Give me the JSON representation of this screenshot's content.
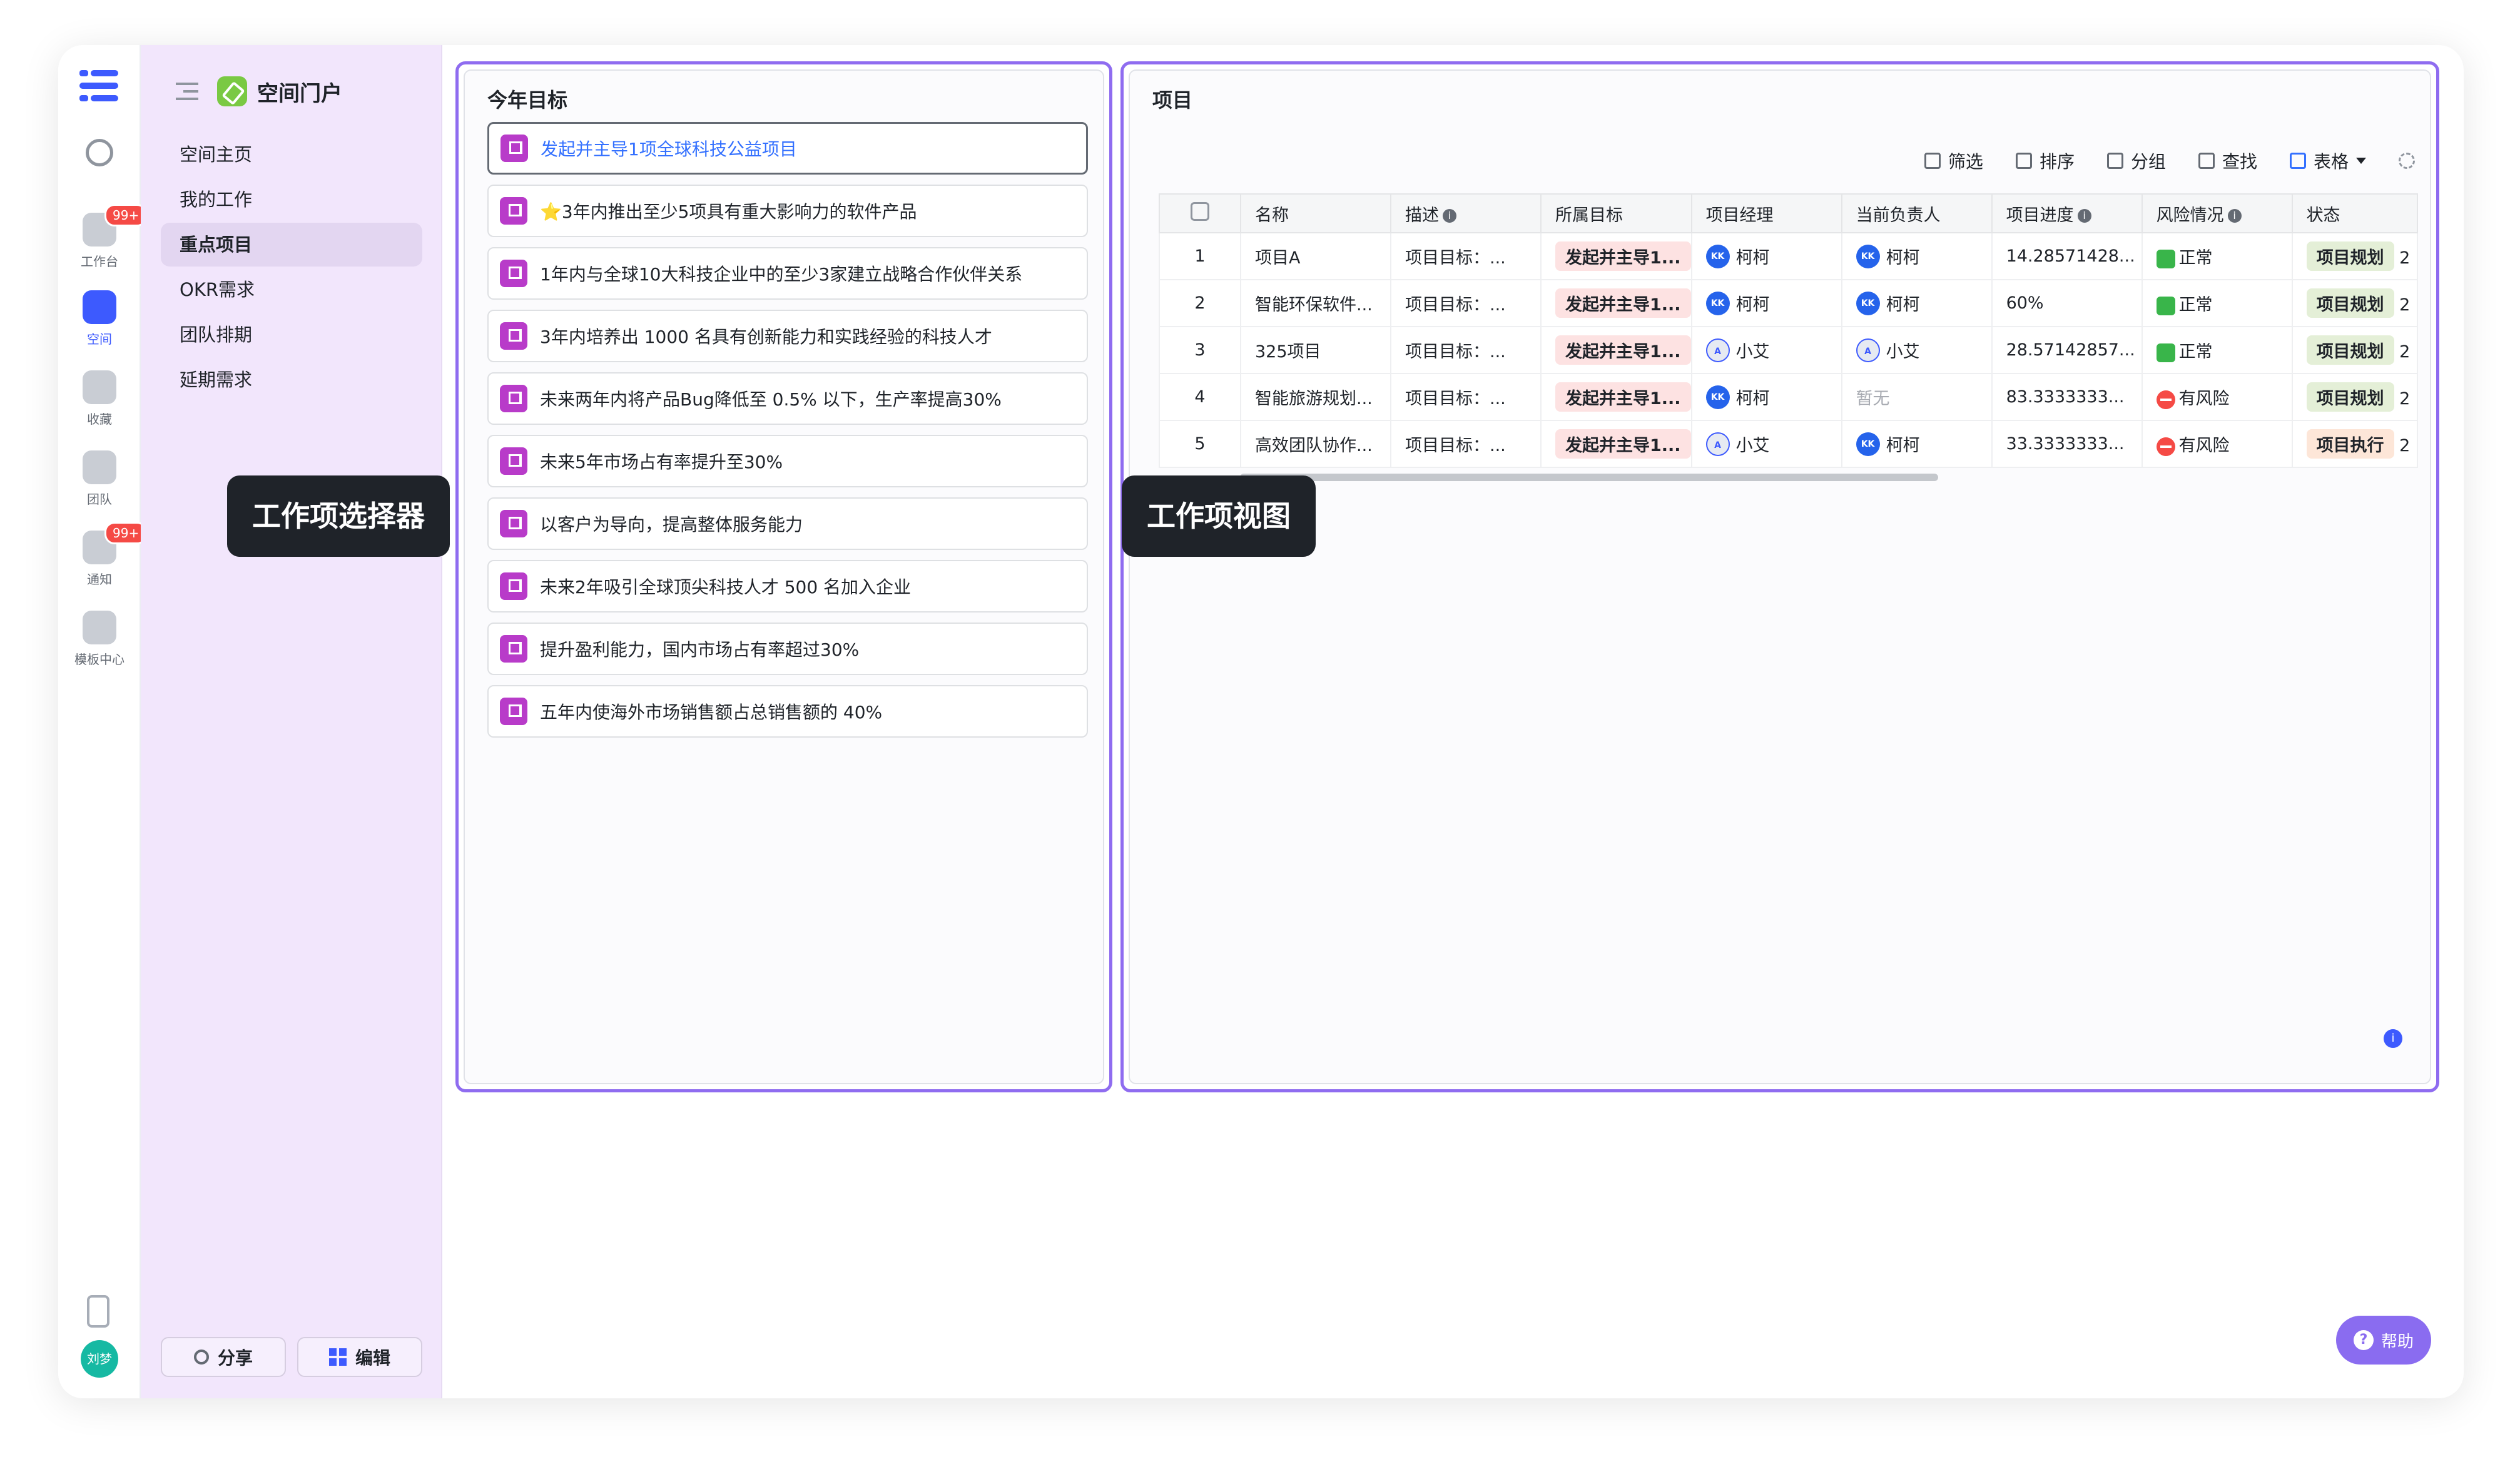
{
  "rail": {
    "items": [
      {
        "label": "工作台",
        "badge": "99+"
      },
      {
        "label": "空间"
      },
      {
        "label": "收藏"
      },
      {
        "label": "团队"
      },
      {
        "label": "通知",
        "badge": "99+"
      },
      {
        "label": "模板中心"
      }
    ],
    "avatar": "刘梦"
  },
  "sidebar": {
    "title": "空间门户",
    "items": [
      "空间主页",
      "我的工作",
      "重点项目",
      "OKR需求",
      "团队排期",
      "延期需求"
    ],
    "share_label": "分享",
    "edit_label": "编辑"
  },
  "goals_panel": {
    "title": "今年目标",
    "items": [
      "发起并主导1项全球科技公益项目",
      "⭐3年内推出至少5项具有重大影响力的软件产品",
      "1年内与全球10大科技企业中的至少3家建立战略合作伙伴关系",
      "3年内培养出 1000 名具有创新能力和实践经验的科技人才",
      "未来两年内将产品Bug降低至 0.5% 以下，生产率提高30%",
      "未来5年市场占有率提升至30%",
      "以客户为导向，提高整体服务能力",
      "未来2年吸引全球顶尖科技人才 500 名加入企业",
      "提升盈利能力，国内市场占有率超过30%",
      "五年内使海外市场销售额占总销售额的 40%"
    ]
  },
  "projects_panel": {
    "title": "项目",
    "toolbar": {
      "filter": "筛选",
      "sort": "排序",
      "group": "分组",
      "find": "查找",
      "view": "表格"
    },
    "columns": [
      "名称",
      "描述",
      "所属目标",
      "项目经理",
      "当前负责人",
      "项目进度",
      "风险情况",
      "状态"
    ],
    "rows": [
      {
        "no": "1",
        "name": "项目A",
        "desc": "项目目标：...",
        "goal": "发起并主导1...",
        "manager": "柯柯",
        "owner": "柯柯",
        "progress": "14.28571428...",
        "risk": "正常",
        "status": "项目规划",
        "extra": "2"
      },
      {
        "no": "2",
        "name": "智能环保软件...",
        "desc": "项目目标：...",
        "goal": "发起并主导1...",
        "manager": "柯柯",
        "owner": "柯柯",
        "progress": "60%",
        "risk": "正常",
        "status": "项目规划",
        "extra": "2"
      },
      {
        "no": "3",
        "name": "325项目",
        "desc": "项目目标：...",
        "goal": "发起并主导1...",
        "manager": "小艾",
        "owner": "小艾",
        "progress": "28.57142857...",
        "risk": "正常",
        "status": "项目规划",
        "extra": "2"
      },
      {
        "no": "4",
        "name": "智能旅游规划...",
        "desc": "项目目标：...",
        "goal": "发起并主导1...",
        "manager": "柯柯",
        "owner": "暂无",
        "progress": "83.3333333...",
        "risk": "有风险",
        "status": "项目规划",
        "extra": "2"
      },
      {
        "no": "5",
        "name": "高效团队协作...",
        "desc": "项目目标：...",
        "goal": "发起并主导1...",
        "manager": "小艾",
        "owner": "柯柯",
        "progress": "33.3333333...",
        "risk": "有风险",
        "status": "项目执行",
        "extra": "2"
      }
    ]
  },
  "callouts": {
    "selector": "工作项选择器",
    "view": "工作项视图"
  },
  "help_label": "帮助",
  "colors": {
    "accent": "#8f6cf0",
    "sidebar_bg": "#f2e6fc",
    "primary": "#3d5afe"
  }
}
